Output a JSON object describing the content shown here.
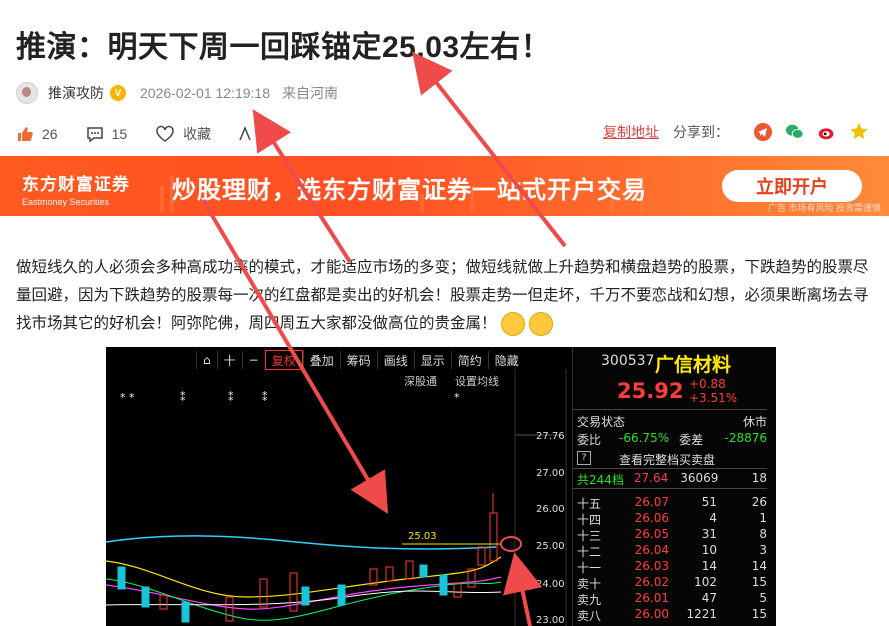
{
  "article": {
    "title": "推演：明天下周一回踩锚定25.03左右！",
    "author": "推演攻防",
    "verified_badge": "V",
    "date": "2026-02-01 12:19:18",
    "location": "来自河南",
    "body": "做短线久的人必须会多种高成功率的模式，才能适应市场的多变；做短线就做上升趋势和横盘趋势的股票，下跌趋势的股票尽量回避，因为下跌趋势的股票每一次的红盘都是卖出的好机会！股票走势一但走坏，千万不要恋战和幻想，必须果断离场去寻找市场其它的好机会！阿弥陀佛，周四周五大家都没做高位的贵金属！"
  },
  "actions": {
    "like_count": "26",
    "comment_count": "15",
    "favorite_label": "收藏",
    "font_label": "A",
    "copy_link_label": "复制地址",
    "share_label": "分享到：",
    "icons": [
      "like-icon",
      "comment-icon",
      "favorite-icon",
      "font-icon",
      "telegram-icon",
      "wechat-icon",
      "weibo-icon",
      "star-icon"
    ]
  },
  "banner": {
    "logo_cn": "东方财富证券",
    "logo_en": "Eastmoney Securities",
    "slogan": "炒股理财，选东方财富证券一站式开户交易",
    "button": "立即开户",
    "note": "广告 市场有风险 投资需谨慎"
  },
  "chart": {
    "toolbar": [
      "十",
      "复权",
      "叠加",
      "筹码",
      "画线",
      "显示",
      "简约",
      "隐藏"
    ],
    "subbar": [
      "深股通",
      "设置均线"
    ],
    "price_labels": [
      "27.76",
      "27.00",
      "26.00",
      "25.00",
      "24.00",
      "23.00"
    ],
    "annotation": "25.03",
    "quote": {
      "code": "300537",
      "name": "广信材料",
      "price": "25.92",
      "change": "+0.88",
      "change_pct": "+3.51%",
      "status_label": "交易状态",
      "status": "休市",
      "weibi_label": "委比",
      "weibi": "-66.75%",
      "weicha_label": "委差",
      "weicha": "-28876",
      "full_book": "查看完整档买卖盘",
      "levels_label": "共244档",
      "levels_price": "27.64",
      "levels_vol": "36069",
      "levels_count": "18",
      "book": [
        {
          "label": "十五",
          "price": "26.07",
          "vol": "51",
          "cnt": "26"
        },
        {
          "label": "十四",
          "price": "26.06",
          "vol": "4",
          "cnt": "1"
        },
        {
          "label": "十三",
          "price": "26.05",
          "vol": "31",
          "cnt": "8"
        },
        {
          "label": "十二",
          "price": "26.04",
          "vol": "10",
          "cnt": "3"
        },
        {
          "label": "十一",
          "price": "26.03",
          "vol": "14",
          "cnt": "14"
        },
        {
          "label": "卖十",
          "price": "26.02",
          "vol": "102",
          "cnt": "15"
        },
        {
          "label": "卖九",
          "price": "26.01",
          "vol": "47",
          "cnt": "5"
        },
        {
          "label": "卖八",
          "price": "26.00",
          "vol": "1221",
          "cnt": "15"
        }
      ]
    }
  }
}
